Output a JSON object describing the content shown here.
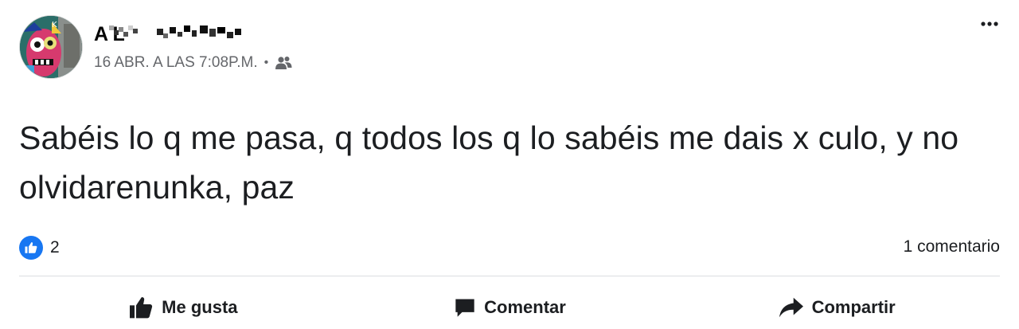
{
  "post": {
    "author": {
      "name": "A L"
    },
    "timestamp": "16 ABR. A LAS 7:08P.M.",
    "separator": "•",
    "audience_icon": "friends-icon",
    "menu_icon": "more-options-icon",
    "text": "Sabéis lo q me pasa, q todos los q lo sabéis me dais x culo, y no olvidarenunka, paz",
    "reactions": {
      "icon": "like-icon",
      "count": "2"
    },
    "comments_label": "1 comentario"
  },
  "actions": {
    "like_label": "Me gusta",
    "comment_label": "Comentar",
    "share_label": "Compartir"
  },
  "colors": {
    "like_blue": "#1877f2",
    "meta_gray": "#65676b",
    "divider": "#dadde1"
  }
}
